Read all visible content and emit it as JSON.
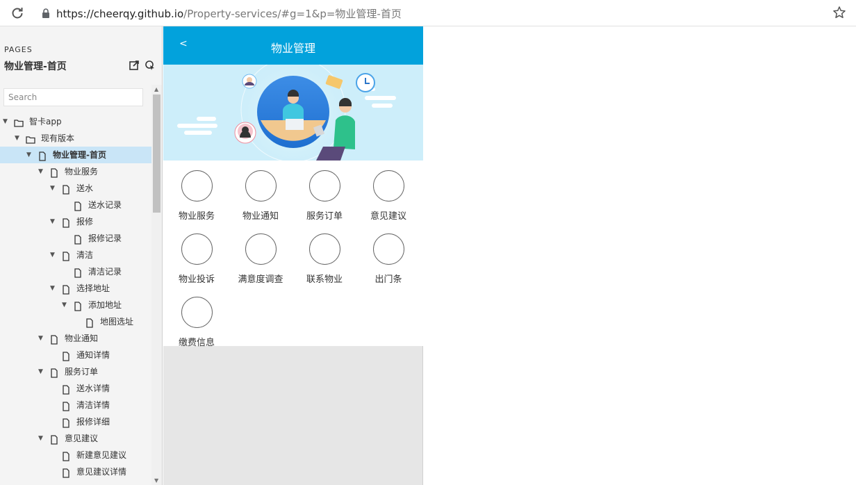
{
  "browser": {
    "url_host": "https://cheerqy.github.io",
    "url_path": "/Property-services/#g=1&p=物业管理-首页"
  },
  "sidebar": {
    "pages_label": "PAGES",
    "current_page": "物业管理-首页",
    "search_placeholder": "Search",
    "tree": [
      {
        "label": "智卡app",
        "level": 0,
        "type": "folder",
        "caret": true
      },
      {
        "label": "现有版本",
        "level": 1,
        "type": "folder",
        "caret": true
      },
      {
        "label": "物业管理-首页",
        "level": 2,
        "type": "page",
        "caret": true,
        "selected": true
      },
      {
        "label": "物业服务",
        "level": 3,
        "type": "page",
        "caret": true
      },
      {
        "label": "送水",
        "level": 4,
        "type": "page",
        "caret": true
      },
      {
        "label": "送水记录",
        "level": 5,
        "type": "page",
        "caret": false
      },
      {
        "label": "报修",
        "level": 4,
        "type": "page",
        "caret": true
      },
      {
        "label": "报修记录",
        "level": 5,
        "type": "page",
        "caret": false
      },
      {
        "label": "清洁",
        "level": 4,
        "type": "page",
        "caret": true
      },
      {
        "label": "清洁记录",
        "level": 5,
        "type": "page",
        "caret": false
      },
      {
        "label": "选择地址",
        "level": 4,
        "type": "page",
        "caret": true
      },
      {
        "label": "添加地址",
        "level": 5,
        "type": "page",
        "caret": true
      },
      {
        "label": "地图选址",
        "level": 6,
        "type": "page",
        "caret": false
      },
      {
        "label": "物业通知",
        "level": 3,
        "type": "page",
        "caret": true
      },
      {
        "label": "通知详情",
        "level": 4,
        "type": "page",
        "caret": false
      },
      {
        "label": "服务订单",
        "level": 3,
        "type": "page",
        "caret": true
      },
      {
        "label": "送水详情",
        "level": 4,
        "type": "page",
        "caret": false
      },
      {
        "label": "清洁详情",
        "level": 4,
        "type": "page",
        "caret": false
      },
      {
        "label": "报修详细",
        "level": 4,
        "type": "page",
        "caret": false
      },
      {
        "label": "意见建议",
        "level": 3,
        "type": "page",
        "caret": true
      },
      {
        "label": "新建意见建议",
        "level": 4,
        "type": "page",
        "caret": false
      },
      {
        "label": "意见建议详情",
        "level": 4,
        "type": "page",
        "caret": false
      }
    ]
  },
  "phone": {
    "back": "<",
    "title": "物业管理",
    "grid": [
      "物业服务",
      "物业通知",
      "服务订单",
      "意见建议",
      "物业投诉",
      "满意度调查",
      "联系物业",
      "出门条",
      "缴费信息"
    ]
  }
}
